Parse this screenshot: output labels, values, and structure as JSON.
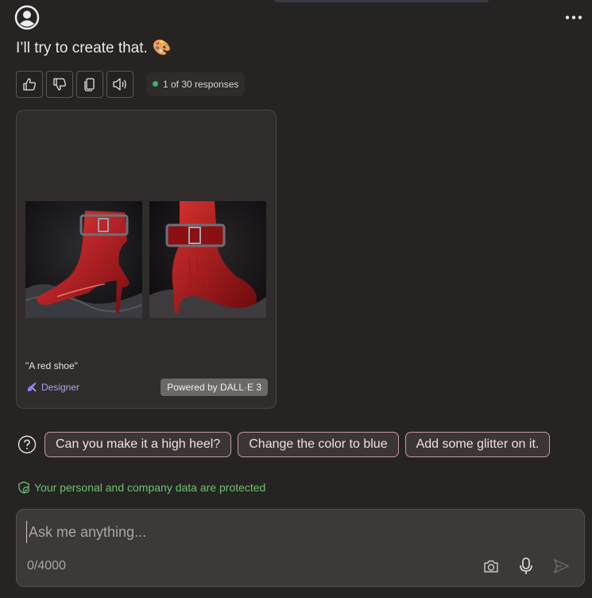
{
  "message": {
    "text": "I’ll try to create that.",
    "emoji": "🎨"
  },
  "actions": {
    "responses_label": "1 of 30 responses"
  },
  "image_card": {
    "prompt": "\"A red shoe\"",
    "designer_label": "Designer",
    "powered_label": "Powered by DALL·E 3"
  },
  "suggestions": [
    {
      "label": "Can you make it a high heel?"
    },
    {
      "label": "Change the color to blue"
    },
    {
      "label": "Add some glitter on it."
    }
  ],
  "privacy": {
    "text": "Your personal and company data are protected"
  },
  "composer": {
    "placeholder": "Ask me anything...",
    "counter": "0/4000"
  },
  "colors": {
    "background": "#262323",
    "accent_green": "#3bb273",
    "designer_purple": "#a9a4f0",
    "chip_border": "#c79a9f"
  },
  "icons": [
    "user-avatar-icon",
    "more-icon",
    "thumbs-up-icon",
    "thumbs-down-icon",
    "copy-icon",
    "speaker-icon",
    "designer-icon",
    "help-icon",
    "shield-check-icon",
    "camera-icon",
    "microphone-icon",
    "send-icon"
  ]
}
